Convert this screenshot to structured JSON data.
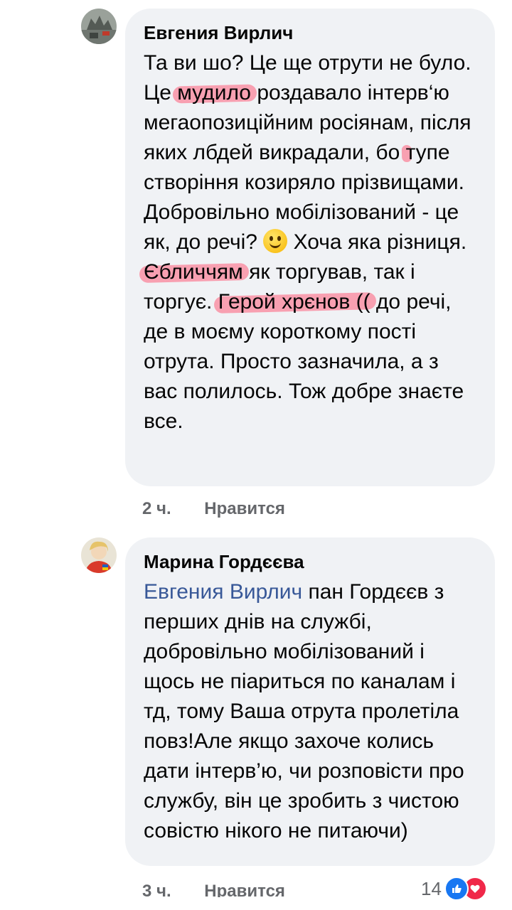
{
  "comments": [
    {
      "author": "Евгения Вирлич",
      "text_parts": [
        "Та ви шо? Це ще отрути не було. Це ",
        "мудило",
        " роздавало інтерв‘ю мегаопозиційним росіянам, після яких лбдей викрадали, бо ",
        "тупе створіння",
        " козиряло прізвищами. Добровільно мобілізований - це як, до речі? ",
        " Хоча яка різниця. ",
        "Єбличчям",
        " як торгував, так і торгує. ",
        "Герой хрєнов ((",
        " до речі, де в моєму короткому пості отрута. Просто зазначила, а з вас полилось. Тож добре знаєте все."
      ],
      "time": "2 ч.",
      "like_label": "Нравится"
    },
    {
      "author": "Марина Гордєєва",
      "mention": "Евгения Вирлич",
      "text": " пан Гордєєв з перших днів на службі, добровільно мобілізований і щось не піариться по каналам і тд, тому Ваша отрута пролетіла повз!Але якщо захоче колись дати інтерв’ю, чи розповісти про службу, він це зробить з чистою совістю нікого не питаючи)",
      "time": "3 ч.",
      "like_label": "Нравится",
      "reaction_count": "14",
      "reaction_icons": [
        "like-icon",
        "heart-icon"
      ]
    }
  ],
  "colors": {
    "bubble": "#f0f2f5",
    "mention": "#385898",
    "highlight": "#ff5c78",
    "meta": "#65676b"
  }
}
